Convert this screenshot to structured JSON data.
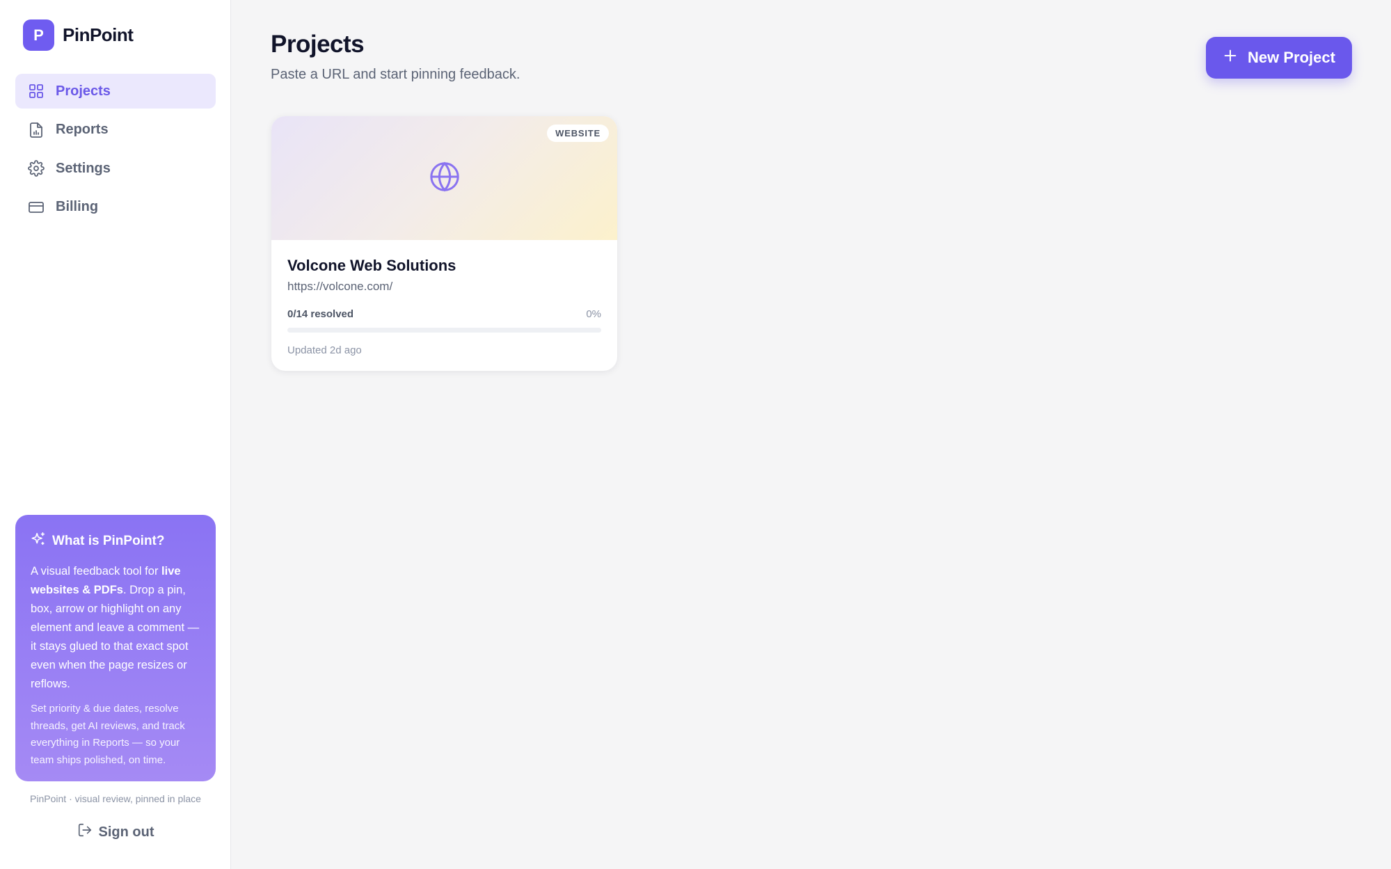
{
  "app": {
    "name": "PinPoint",
    "logo_letter": "P",
    "accent_color": "#6a58ec"
  },
  "sidebar": {
    "items": [
      {
        "label": "Projects",
        "icon": "grid-icon",
        "active": true
      },
      {
        "label": "Reports",
        "icon": "report-file-icon",
        "active": false
      },
      {
        "label": "Settings",
        "icon": "gear-icon",
        "active": false
      },
      {
        "label": "Billing",
        "icon": "credit-card-icon",
        "active": false
      }
    ],
    "info_card": {
      "icon": "sparkles-icon",
      "title": "What is PinPoint?",
      "body_pre": "A visual feedback tool for ",
      "body_bold": "live websites & PDFs",
      "body_post": ". Drop a pin, box, arrow or highlight on any element and leave a comment — it stays glued to that exact spot even when the page resizes or reflows.",
      "footer": "Set priority & due dates, resolve threads, get AI reviews, and track everything in Reports — so your team ships polished, on time."
    },
    "tagline": "PinPoint · visual review, pinned in place",
    "sign_out_label": "Sign out"
  },
  "main": {
    "title": "Projects",
    "subtitle": "Paste a URL and start pinning feedback.",
    "new_project_label": "New Project",
    "projects": [
      {
        "type_badge": "WEBSITE",
        "icon": "globe-icon",
        "name": "Volcone Web Solutions",
        "url": "https://volcone.com/",
        "resolved_text": "0/14 resolved",
        "percent_text": "0%",
        "progress": 0,
        "updated": "Updated 2d ago"
      }
    ]
  }
}
